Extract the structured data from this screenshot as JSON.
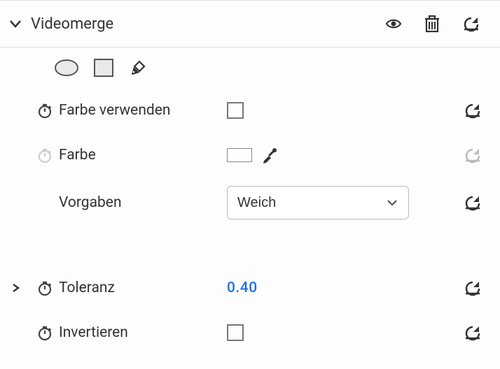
{
  "header": {
    "title": "Videomerge"
  },
  "params": {
    "use_color": {
      "label": "Farbe verwenden",
      "checked": false
    },
    "color": {
      "label": "Farbe",
      "value": "#ffffff",
      "enabled": false
    },
    "preset": {
      "label": "Vorgaben",
      "selected": "Weich"
    },
    "tolerance": {
      "label": "Toleranz",
      "value": "0.40"
    },
    "invert": {
      "label": "Invertieren",
      "checked": false
    }
  }
}
